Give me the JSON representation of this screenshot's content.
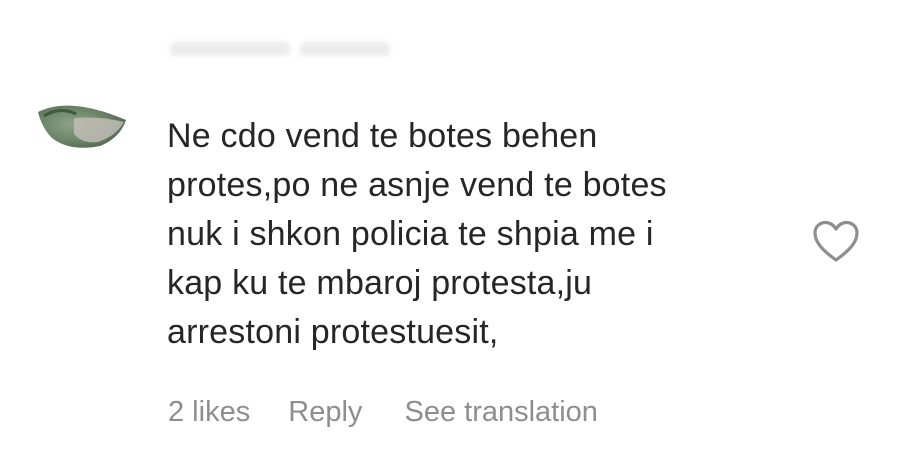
{
  "comment": {
    "avatar_icon": "user-avatar",
    "lines": [
      "Ne cdo vend te botes behen",
      "protes,po ne asnje vend te botes",
      "nuk i shkon policia te shpia me i",
      "kap ku te mbaroj protesta,ju",
      "arrestoni protestuesit,"
    ],
    "like_icon": "heart-outline-icon"
  },
  "actions": {
    "likes": "2 likes",
    "reply": "Reply",
    "see_translation": "See translation"
  },
  "colors": {
    "text": "#262626",
    "secondary": "#8e8e8e",
    "icon": "#8e8e8e"
  }
}
